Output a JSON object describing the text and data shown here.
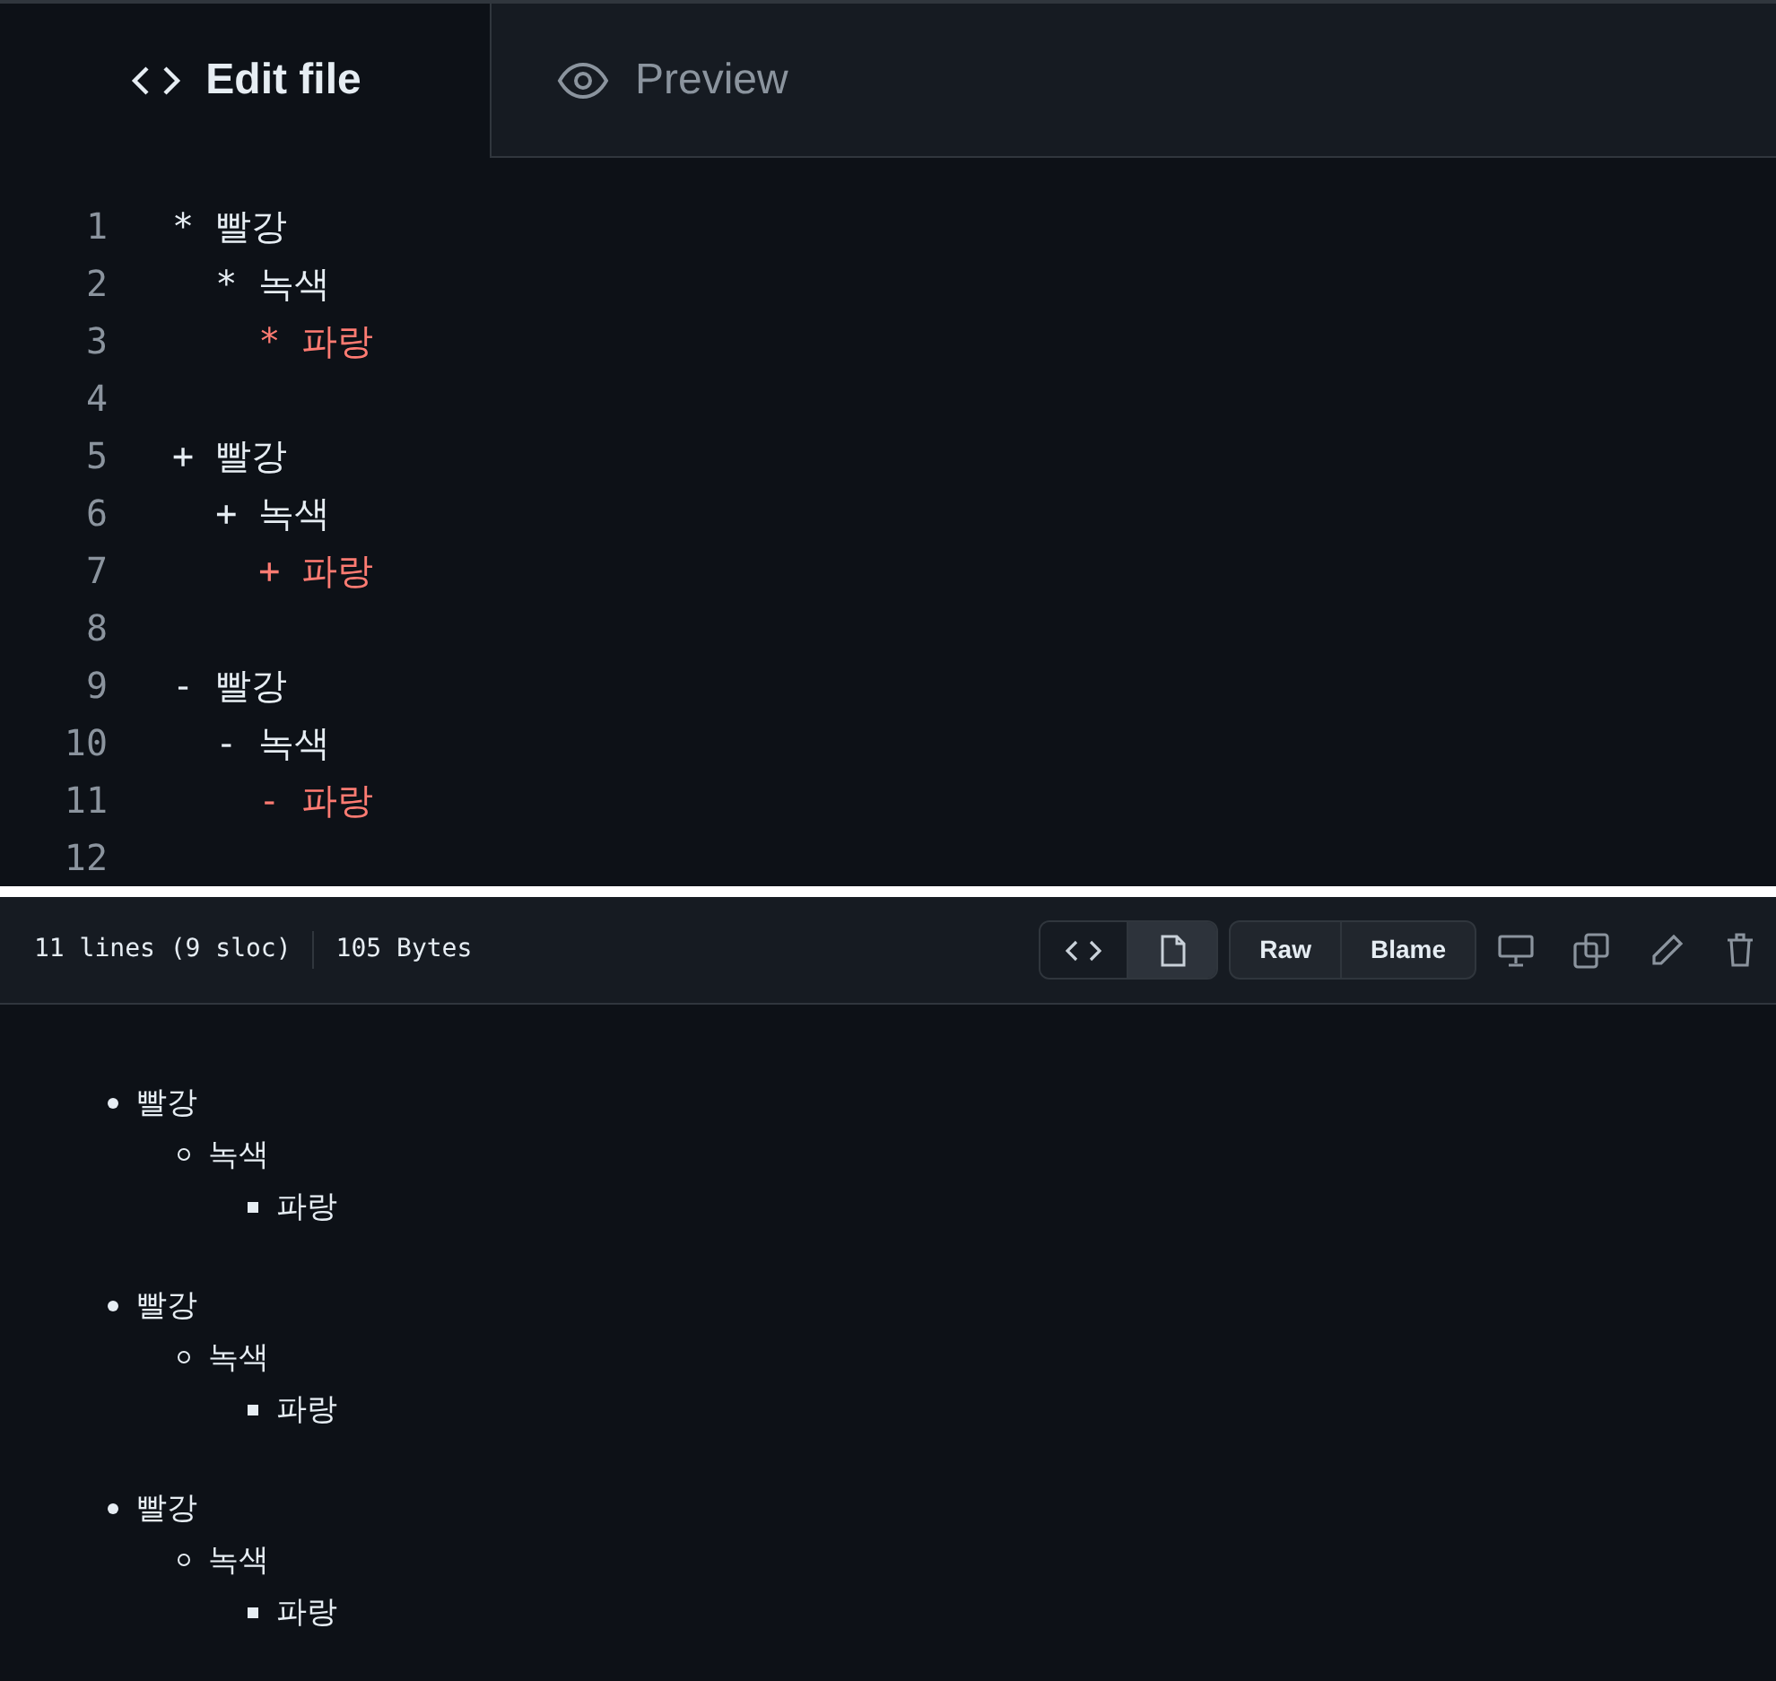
{
  "tabs": [
    {
      "label": "Edit file",
      "selected": true
    },
    {
      "label": "Preview",
      "selected": false
    }
  ],
  "editor": {
    "lines": [
      {
        "number": "1",
        "text": "* 빨강",
        "color": "#e6edf3"
      },
      {
        "number": "2",
        "text": "  * 녹색",
        "color": "#e6edf3"
      },
      {
        "number": "3",
        "text": "    * 파랑",
        "color": "#ff7b72"
      },
      {
        "number": "4"
      },
      {
        "number": "5",
        "text": "+ 빨강",
        "color": "#e6edf3"
      },
      {
        "number": "6",
        "text": "  + 녹색",
        "color": "#e6edf3"
      },
      {
        "number": "7",
        "text": "    + 파랑",
        "color": "#ff7b72"
      },
      {
        "number": "8"
      },
      {
        "number": "9",
        "text": "- 빨강",
        "color": "#e6edf3"
      },
      {
        "number": "10",
        "text": "  - 녹색",
        "color": "#e6edf3"
      },
      {
        "number": "11",
        "text": "    - 파랑",
        "color": "#ff7b72"
      },
      {
        "number": "12"
      }
    ]
  },
  "file_header": {
    "view_switch": [
      {
        "selected": false
      },
      {
        "selected": true
      }
    ],
    "lines_info": "11 lines (9 sloc)",
    "size": "105 Bytes",
    "buttons": [
      "Raw",
      "Blame"
    ]
  },
  "preview": {
    "lists": [
      {
        "text": "빨강",
        "children": [
          {
            "text": "녹색",
            "children": [
              {
                "text": "파랑"
              }
            ]
          }
        ]
      },
      {
        "text": "빨강",
        "children": [
          {
            "text": "녹색",
            "children": [
              {
                "text": "파랑"
              }
            ]
          }
        ]
      },
      {
        "text": "빨강",
        "children": [
          {
            "text": "녹색",
            "children": [
              {
                "text": "파랑"
              }
            ]
          }
        ]
      }
    ]
  }
}
